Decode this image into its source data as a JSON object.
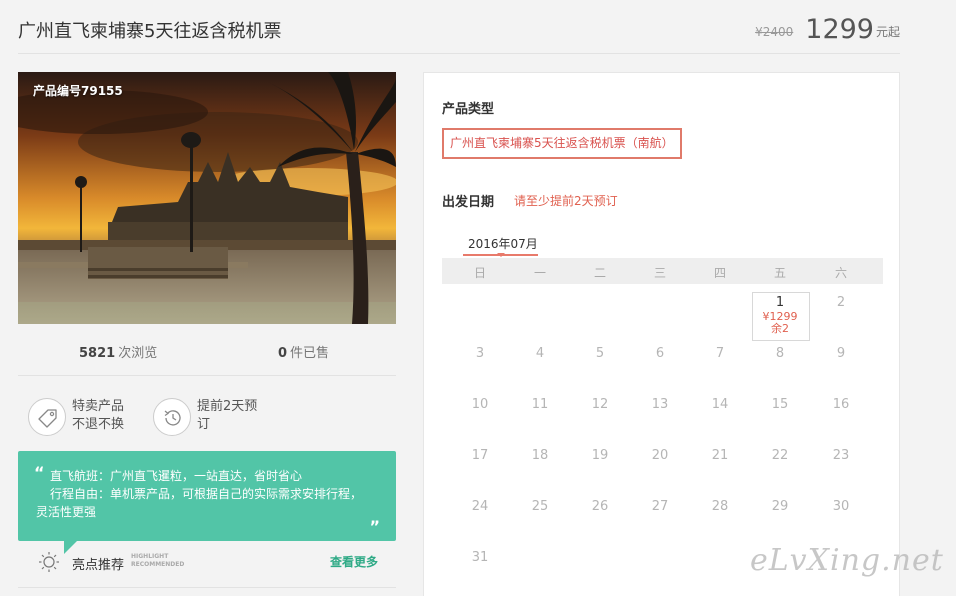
{
  "header": {
    "title": "广州直飞柬埔寨5天往返含税机票",
    "old_price": "¥2400",
    "price": "1299",
    "price_unit": "元起"
  },
  "hero": {
    "product_code": "产品编号79155"
  },
  "stats": {
    "views_count": "5821",
    "views_label": "次浏览",
    "sold_count": "0",
    "sold_label": "件已售"
  },
  "features": [
    {
      "icon": "tag-icon",
      "line1": "特卖产品",
      "line2": "不退不换"
    },
    {
      "icon": "clock-history-icon",
      "line1": "提前2天预",
      "line2": "订"
    }
  ],
  "quote": {
    "open_mark": "“",
    "line1": "直飞航班：广州直飞暹粒，一站直达，省时省心",
    "line2": "行程自由：单机票产品，可根据自己的实际需求安排行程，",
    "line3": "灵活性更强",
    "close_mark": "”"
  },
  "highlight": {
    "icon": "sun-icon",
    "title": "亮点推荐",
    "sub_line1": "HIGHLIGHT",
    "sub_line2": "RECOMMENDED",
    "more_link": "查看更多"
  },
  "booking": {
    "type_label": "产品类型",
    "type_option": "广州直飞柬埔寨5天往返含税机票（南航）",
    "date_label": "出发日期",
    "date_note": "请至少提前2天预订",
    "month_tab": "2016年07月",
    "weekdays": [
      "日",
      "一",
      "二",
      "三",
      "四",
      "五",
      "六"
    ],
    "active_day": {
      "day": "1",
      "price": "¥1299",
      "remaining": "余2"
    },
    "days": [
      "2",
      "3",
      "4",
      "5",
      "6",
      "7",
      "8",
      "9",
      "10",
      "11",
      "12",
      "13",
      "14",
      "15",
      "16",
      "17",
      "18",
      "19",
      "20",
      "21",
      "22",
      "23",
      "24",
      "25",
      "26",
      "27",
      "28",
      "29",
      "30",
      "31"
    ]
  },
  "watermark": "eLvXing.net",
  "colors": {
    "accent_red": "#e0604f",
    "accent_green": "#52c5a7",
    "link_green": "#2faa86"
  }
}
